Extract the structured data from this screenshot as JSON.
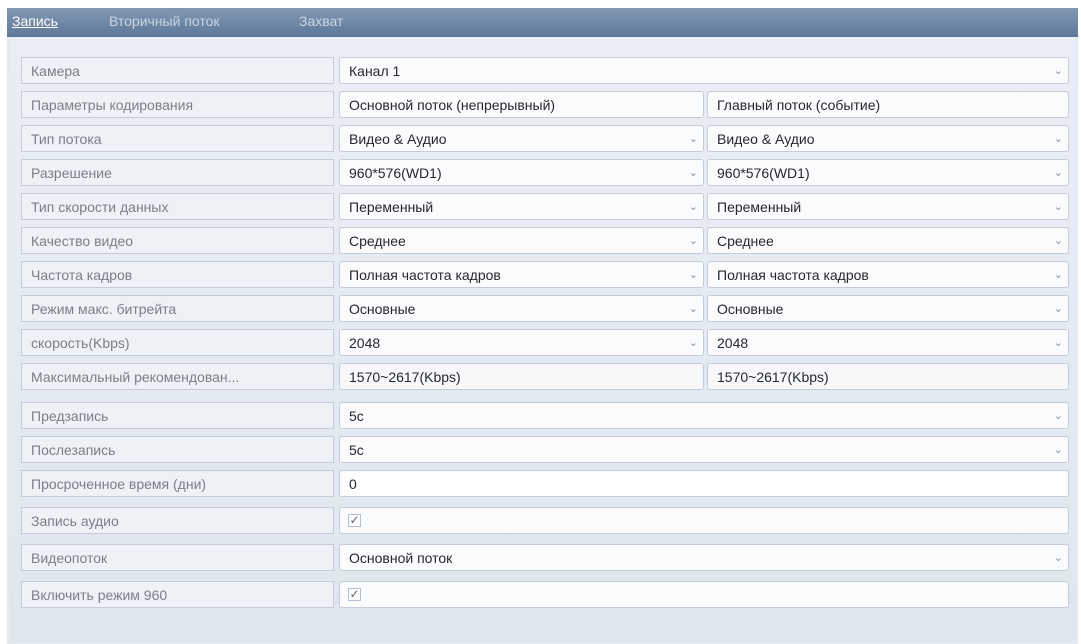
{
  "tabs": [
    {
      "label": "Запись",
      "active": true
    },
    {
      "label": "Вторичный поток",
      "active": false
    },
    {
      "label": "Захват",
      "active": false
    }
  ],
  "camera": {
    "label": "Камера",
    "value": "Канал 1"
  },
  "encoding": {
    "label": "Параметры кодирования",
    "col1": "Основной поток (непрерывный)",
    "col2": "Главный поток (событие)"
  },
  "rows": [
    {
      "label": "Тип потока",
      "v1": "Видео & Аудио",
      "v2": "Видео & Аудио"
    },
    {
      "label": "Разрешение",
      "v1": "960*576(WD1)",
      "v2": "960*576(WD1)"
    },
    {
      "label": "Тип скорости данных",
      "v1": "Переменный",
      "v2": "Переменный"
    },
    {
      "label": "Качество видео",
      "v1": "Среднее",
      "v2": "Среднее"
    },
    {
      "label": "Частота кадров",
      "v1": "Полная частота кадров",
      "v2": "Полная частота кадров"
    },
    {
      "label": "Режим макс. битрейта",
      "v1": "Основные",
      "v2": "Основные"
    },
    {
      "label": "скорость(Kbps)",
      "v1": "2048",
      "v2": "2048"
    }
  ],
  "max_recommended": {
    "label": "Максимальный рекомендован...",
    "v1": "1570~2617(Kbps)",
    "v2": "1570~2617(Kbps)"
  },
  "prerecord": {
    "label": "Предзапись",
    "value": "5с"
  },
  "postrecord": {
    "label": "Послезапись",
    "value": "5с"
  },
  "expired": {
    "label": "Просроченное время (дни)",
    "value": "0"
  },
  "audio_record": {
    "label": "Запись аудио",
    "checked": true
  },
  "video_stream": {
    "label": "Видеопоток",
    "value": "Основной поток"
  },
  "mode960": {
    "label": "Включить режим 960",
    "checked": true
  },
  "glyphs": {
    "dropdown": "⌄",
    "check": "✓"
  }
}
